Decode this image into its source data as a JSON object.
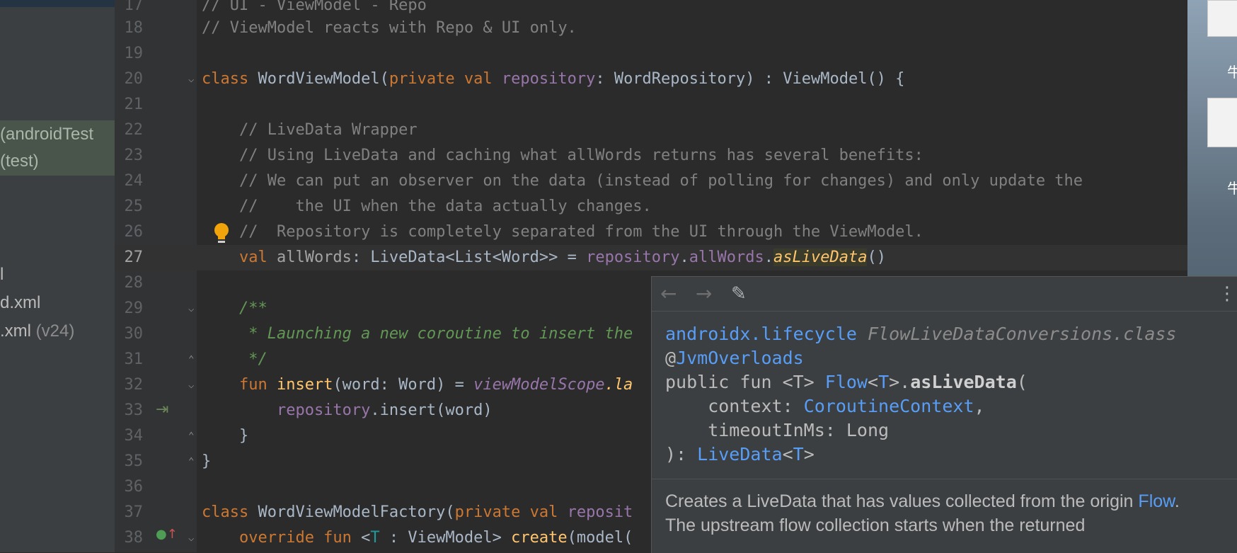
{
  "project_panel": {
    "items": [
      {
        "label": "(androidTest",
        "suffix": "",
        "highlight": true
      },
      {
        "label": "(test)",
        "suffix": "",
        "highlight": true
      },
      {
        "label": "l",
        "suffix": "",
        "highlight": false
      },
      {
        "label": "d.xml",
        "suffix": "",
        "highlight": false
      },
      {
        "label": ".xml",
        "suffix": " (v24)",
        "highlight": false
      }
    ]
  },
  "editor": {
    "lines": {
      "17": {
        "num": "17",
        "comment": "// UI - ViewModel - Repo"
      },
      "18": {
        "num": "18",
        "comment": "// ViewModel reacts with Repo & UI only."
      },
      "19": {
        "num": "19"
      },
      "20": {
        "num": "20",
        "t1": "class",
        "t2": " WordViewModel(",
        "t3": "private val",
        "t4": " repository",
        "t5": ": WordRepository) : ViewModel() {"
      },
      "21": {
        "num": "21"
      },
      "22": {
        "num": "22",
        "comment": "    // LiveData Wrapper"
      },
      "23": {
        "num": "23",
        "comment": "    // Using LiveData and caching what allWords returns has several benefits:"
      },
      "24": {
        "num": "24",
        "comment": "    // We can put an observer on the data (instead of polling for changes) and only update the"
      },
      "25": {
        "num": "25",
        "comment": "    //    the UI when the data actually changes."
      },
      "26": {
        "num": "26",
        "comment": "    //  Repository is completely separated from the UI through the ViewModel."
      },
      "27": {
        "num": "27",
        "t1": "    val",
        "t2": " allWords",
        "t3": ": LiveData<List<Word>> = ",
        "t4": "repository",
        "t5": ".",
        "t6": "allWords",
        "t7": ".",
        "t8": "asLiveData",
        "t9": "()"
      },
      "28": {
        "num": "28"
      },
      "29": {
        "num": "29",
        "doc": "    /**"
      },
      "30": {
        "num": "30",
        "doc": "     * Launching a new coroutine to insert the"
      },
      "31": {
        "num": "31",
        "doc": "     */"
      },
      "32": {
        "num": "32",
        "t1": "    fun",
        "t2": " insert",
        "t3": "(word: Word) = ",
        "t4": "viewModelScope",
        "t5": ".la"
      },
      "33": {
        "num": "33",
        "t1": "        repository",
        "t2": ".insert(word)"
      },
      "34": {
        "num": "34",
        "t1": "    }"
      },
      "35": {
        "num": "35",
        "t1": "}"
      },
      "36": {
        "num": "36"
      },
      "37": {
        "num": "37",
        "t1": "class",
        "t2": " WordViewModelFactory(",
        "t3": "private val",
        "t4": " reposit"
      },
      "38": {
        "num": "38",
        "t1": "    override fun",
        "t2": " <",
        "t3": "T",
        "t4": " : ViewModel> ",
        "t5": "create",
        "t6": "(model("
      }
    }
  },
  "doc_popup": {
    "toolbar": {
      "back": "←",
      "forward": "→",
      "edit": "✎",
      "more": "⋮"
    },
    "package": "androidx.lifecycle",
    "class_file": "FlowLiveDataConversions.class",
    "at": "@",
    "annotation": "JvmOverloads",
    "sig_public": "public fun <T> ",
    "sig_flow": "Flow",
    "sig_lt": "<",
    "sig_T": "T",
    "sig_gt_dot": ">.",
    "sig_name": "asLiveData",
    "sig_paren": "(",
    "param1_name": "    context: ",
    "param1_type": "CoroutineContext",
    "param1_comma": ",",
    "param2": "    timeoutInMs: Long",
    "ret_prefix": "): ",
    "ret_type": "LiveData",
    "ret_lt": "<",
    "ret_T": "T",
    "ret_gt": ">",
    "desc_text": "Creates a LiveData that has values collected from the origin ",
    "desc_link": "Flow",
    "desc_end": ".",
    "desc_more": "The upstream flow collection starts when the returned"
  },
  "desktop": {
    "label1": "牛",
    "label2": "牛"
  },
  "colors": {
    "editor_bg": "#2b2b2b",
    "keyword": "#cc7832",
    "comment": "#808080",
    "doc_comment": "#629755",
    "property": "#9876aa",
    "function": "#ffc66d",
    "link": "#589df6"
  }
}
